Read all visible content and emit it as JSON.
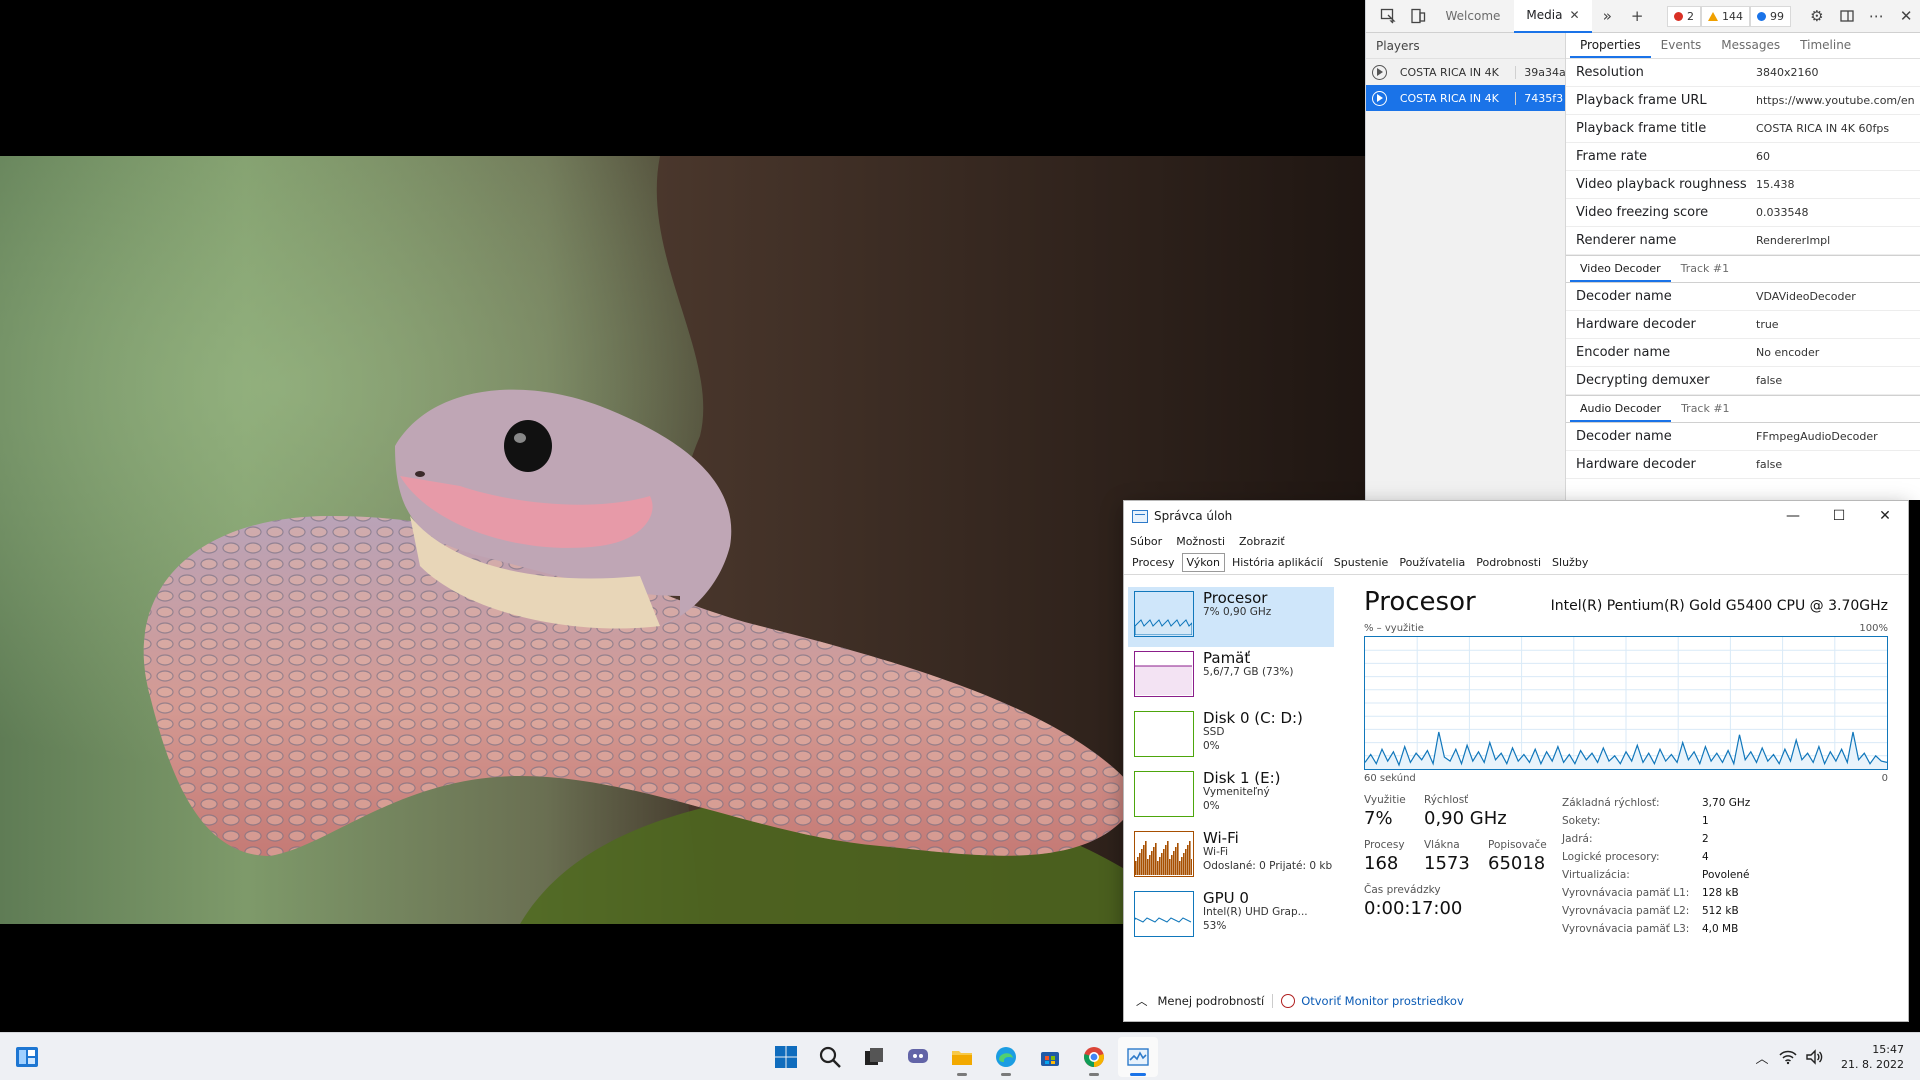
{
  "devtools": {
    "tabs": [
      {
        "label": "Welcome"
      },
      {
        "label": "Media"
      }
    ],
    "badges": {
      "errors": "2",
      "warnings": "144",
      "info": "99"
    },
    "players_title": "Players",
    "players": [
      {
        "name": "COSTA RICA IN 4K",
        "id": "39a34a"
      },
      {
        "name": "COSTA RICA IN 4K",
        "id": "7435f3"
      }
    ],
    "subtabs": [
      "Properties",
      "Events",
      "Messages",
      "Timeline"
    ],
    "properties": [
      {
        "key": "Resolution",
        "value": "3840x2160"
      },
      {
        "key": "Playback frame URL",
        "value": "https://www.youtube.com/en"
      },
      {
        "key": "Playback frame title",
        "value": "COSTA RICA IN 4K 60fps"
      },
      {
        "key": "Frame rate",
        "value": "60"
      },
      {
        "key": "Video playback roughness",
        "value": "15.438"
      },
      {
        "key": "Video freezing score",
        "value": "0.033548"
      },
      {
        "key": "Renderer name",
        "value": "RendererImpl"
      }
    ],
    "video_decoder": {
      "tabs": [
        "Video Decoder",
        "Track #1"
      ],
      "rows": [
        {
          "key": "Decoder name",
          "value": "VDAVideoDecoder"
        },
        {
          "key": "Hardware decoder",
          "value": "true"
        },
        {
          "key": "Encoder name",
          "value": "No encoder"
        },
        {
          "key": "Decrypting demuxer",
          "value": "false"
        }
      ]
    },
    "audio_decoder": {
      "tabs": [
        "Audio Decoder",
        "Track #1"
      ],
      "rows": [
        {
          "key": "Decoder name",
          "value": "FFmpegAudioDecoder"
        },
        {
          "key": "Hardware decoder",
          "value": "false"
        }
      ]
    }
  },
  "taskmgr": {
    "title": "Správca úloh",
    "menu": [
      "Súbor",
      "Možnosti",
      "Zobraziť"
    ],
    "tabs": [
      "Procesy",
      "Výkon",
      "História aplikácií",
      "Spustenie",
      "Používatelia",
      "Podrobnosti",
      "Služby"
    ],
    "side": [
      {
        "name": "Procesor",
        "l1": "7% 0,90 GHz",
        "l2": "",
        "l3": "",
        "color": "#1177bb"
      },
      {
        "name": "Pamäť",
        "l1": "5,6/7,7 GB (73%)",
        "l2": "",
        "l3": "",
        "color": "#8b1e8b"
      },
      {
        "name": "Disk 0 (C: D:)",
        "l1": "SSD",
        "l2": "0%",
        "l3": "",
        "color": "#4da60c"
      },
      {
        "name": "Disk 1 (E:)",
        "l1": "Vymeniteľný",
        "l2": "0%",
        "l3": "",
        "color": "#4da60c"
      },
      {
        "name": "Wi-Fi",
        "l1": "Wi-Fi",
        "l2": "Odoslané: 0 Prijaté: 0 kb",
        "l3": "",
        "color": "#a74f01"
      },
      {
        "name": "GPU 0",
        "l1": "Intel(R) UHD Grap...",
        "l2": "53%",
        "l3": "",
        "color": "#1177bb"
      }
    ],
    "cpu_title": "Procesor",
    "cpu_name": "Intel(R) Pentium(R) Gold G5400 CPU @ 3.70GHz",
    "graph_label_left": "% – využitie",
    "graph_label_right": "100%",
    "graph_bottom_left": "60 sekúnd",
    "graph_bottom_right": "0",
    "graph_values": [
      5,
      11,
      4,
      15,
      6,
      13,
      3,
      17,
      5,
      12,
      7,
      14,
      4,
      28,
      9,
      6,
      15,
      4,
      18,
      6,
      13,
      5,
      20,
      7,
      12,
      4,
      16,
      6,
      11,
      5,
      15,
      4,
      13,
      6,
      17,
      5,
      11,
      4,
      14,
      7,
      12,
      5,
      16,
      6,
      10,
      4,
      13,
      6,
      18,
      5,
      12,
      4,
      15,
      6,
      11,
      5,
      20,
      7,
      13,
      4,
      17,
      6,
      12,
      5,
      14,
      4,
      26,
      7,
      13,
      5,
      16,
      6,
      11,
      4,
      15,
      6,
      22,
      7,
      12,
      5,
      17,
      4,
      13,
      6,
      15,
      5,
      28,
      7,
      12,
      4,
      10,
      6,
      5
    ],
    "stats": {
      "utilization_label": "Využitie",
      "utilization": "7%",
      "speed_label": "Rýchlosť",
      "speed": "0,90 GHz",
      "processes_label": "Procesy",
      "processes": "168",
      "threads_label": "Vlákna",
      "threads": "1573",
      "handles_label": "Popisovače",
      "handles": "65018",
      "uptime_label": "Čas prevádzky",
      "uptime": "0:00:17:00"
    },
    "details": [
      {
        "key": "Základná rýchlosť:",
        "value": "3,70 GHz"
      },
      {
        "key": "Sokety:",
        "value": "1"
      },
      {
        "key": "Jadrá:",
        "value": "2"
      },
      {
        "key": "Logické procesory:",
        "value": "4"
      },
      {
        "key": "Virtualizácia:",
        "value": "Povolené"
      },
      {
        "key": "Vyrovnávacia pamäť L1:",
        "value": "128 kB"
      },
      {
        "key": "Vyrovnávacia pamäť L2:",
        "value": "512 kB"
      },
      {
        "key": "Vyrovnávacia pamäť L3:",
        "value": "4,0 MB"
      }
    ],
    "footer": {
      "less": "Menej podrobností",
      "monitor": "Otvoriť Monitor prostriedkov"
    }
  },
  "taskbar": {
    "apps": [
      "windows-start",
      "search",
      "task-view",
      "chat",
      "file-explorer",
      "edge",
      "store",
      "chrome",
      "task-manager"
    ],
    "clock_time": "15:47",
    "clock_date": "21. 8. 2022"
  }
}
